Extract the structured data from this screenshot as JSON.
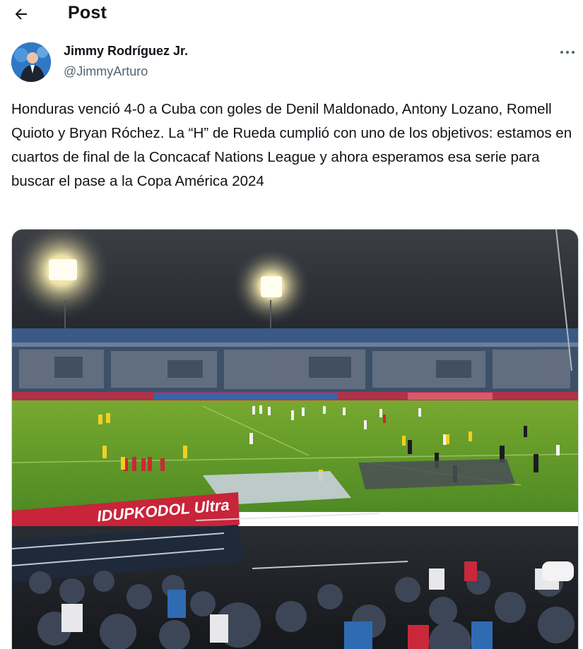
{
  "header": {
    "title": "Post",
    "back_icon": "arrow-left-icon"
  },
  "author": {
    "name": "Jimmy Rodríguez Jr.",
    "handle": "@JimmyArturo",
    "avatar_icon": "avatar"
  },
  "post": {
    "text": "Honduras venció 4-0 a Cuba con goles de Denil Maldonado, Antony Lozano, Romell Quioto y Bryan Róchez. La “H” de Rueda cumplió con uno de los objetivos: estamos en cuartos de final de la Concacaf Nations League y ahora esperamos esa serie para buscar el pase a la Copa América 2024",
    "more_icon": "more-options-icon"
  },
  "media": {
    "banner_text": "IDUPKODOL Ultra"
  },
  "colors": {
    "text": "#0f1419",
    "secondary": "#536471",
    "pitch": "#5f9a2a"
  }
}
